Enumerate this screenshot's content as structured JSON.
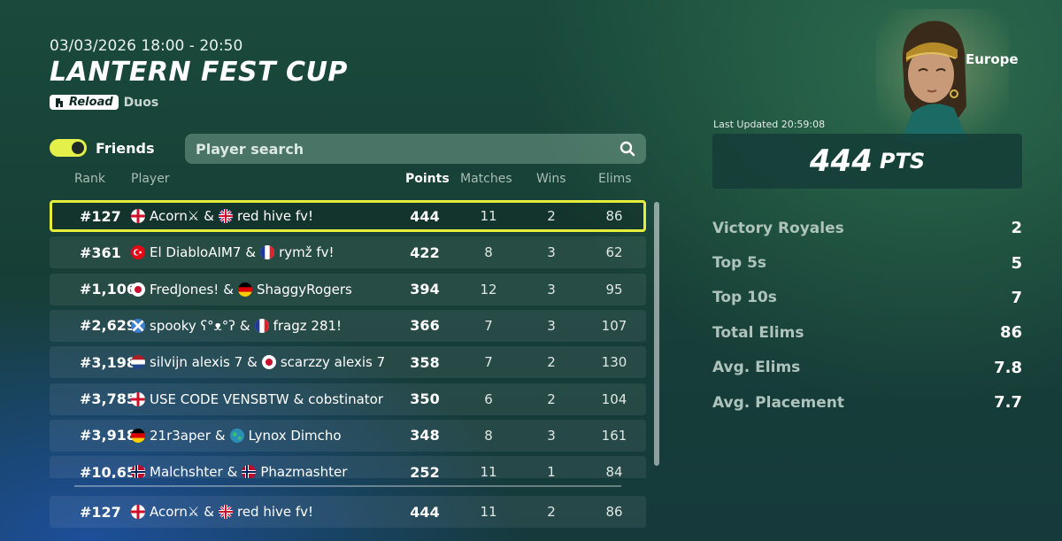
{
  "event": {
    "date_range": "03/03/2026 18:00 - 20:50",
    "title": "LANTERN FEST CUP",
    "mode_badge": "Reload",
    "mode": "Duos"
  },
  "filters": {
    "friends_label": "Friends",
    "friends_on": true,
    "search_placeholder": "Player search"
  },
  "columns": {
    "rank": "Rank",
    "player": "Player",
    "points": "Points",
    "matches": "Matches",
    "wins": "Wins",
    "elims": "Elims"
  },
  "rows": [
    {
      "rank": "#127",
      "p1": "Acorn⚔",
      "p1_flag": "england",
      "sep": "&",
      "p2": "red hive fv!",
      "p2_flag": "uk",
      "points": "444",
      "matches": "11",
      "wins": "2",
      "elims": "86"
    },
    {
      "rank": "#361",
      "p1": "El DiabloAIM7",
      "p1_flag": "turkey",
      "sep": "&",
      "p2": "rymž fv!",
      "p2_flag": "france",
      "points": "422",
      "matches": "8",
      "wins": "3",
      "elims": "62"
    },
    {
      "rank": "#1,106",
      "p1": "FredJones!",
      "p1_flag": "japan",
      "sep": "&",
      "p2": "ShaggyRogers",
      "p2_flag": "germany",
      "points": "394",
      "matches": "12",
      "wins": "3",
      "elims": "95"
    },
    {
      "rank": "#2,629",
      "p1": "spooky ʕ°ᴥ°ʔ",
      "p1_flag": "scotland",
      "sep": "&",
      "p2": "fragz 281!",
      "p2_flag": "france",
      "points": "366",
      "matches": "7",
      "wins": "3",
      "elims": "107"
    },
    {
      "rank": "#3,198",
      "p1": "silvijn alexis 7",
      "p1_flag": "netherlands",
      "sep": "&",
      "p2": "scarzzy alexis 7",
      "p2_flag": "japan",
      "points": "358",
      "matches": "7",
      "wins": "2",
      "elims": "130"
    },
    {
      "rank": "#3,785",
      "p1": "USE CODE VENSBTW",
      "p1_flag": "england",
      "sep": "&",
      "p2": "cobstinator",
      "p2_flag": "",
      "points": "350",
      "matches": "6",
      "wins": "2",
      "elims": "104"
    },
    {
      "rank": "#3,918",
      "p1": "21r3aper",
      "p1_flag": "germany",
      "sep": "&",
      "p2": "Lynox Dimcho",
      "p2_flag": "globe",
      "points": "348",
      "matches": "8",
      "wins": "3",
      "elims": "161"
    },
    {
      "rank": "#10,658",
      "p1": "Malchshter",
      "p1_flag": "norway",
      "sep": "&",
      "p2": "Phazmashter",
      "p2_flag": "norway",
      "points": "252",
      "matches": "11",
      "wins": "1",
      "elims": "84"
    }
  ],
  "pinned": {
    "rank": "#127",
    "p1": "Acorn⚔",
    "p1_flag": "england",
    "sep": "&",
    "p2": "red hive fv!",
    "p2_flag": "uk",
    "points": "444",
    "matches": "11",
    "wins": "2",
    "elims": "86"
  },
  "summary": {
    "region": "Europe",
    "last_updated": "Last Updated 20:59:08",
    "points": "444",
    "points_unit": "PTS",
    "stats": [
      {
        "label": "Victory Royales",
        "value": "2"
      },
      {
        "label": "Top 5s",
        "value": "5"
      },
      {
        "label": "Top 10s",
        "value": "7"
      },
      {
        "label": "Total Elims",
        "value": "86"
      },
      {
        "label": "Avg. Elims",
        "value": "7.8"
      },
      {
        "label": "Avg. Placement",
        "value": "7.7"
      }
    ]
  },
  "colors": {
    "highlight": "#e6ec3a",
    "toggle_on": "#e4f04a"
  },
  "icons": {
    "search": "search-icon",
    "reload_logo": "reload-logo-icon",
    "character": "character-portrait"
  }
}
